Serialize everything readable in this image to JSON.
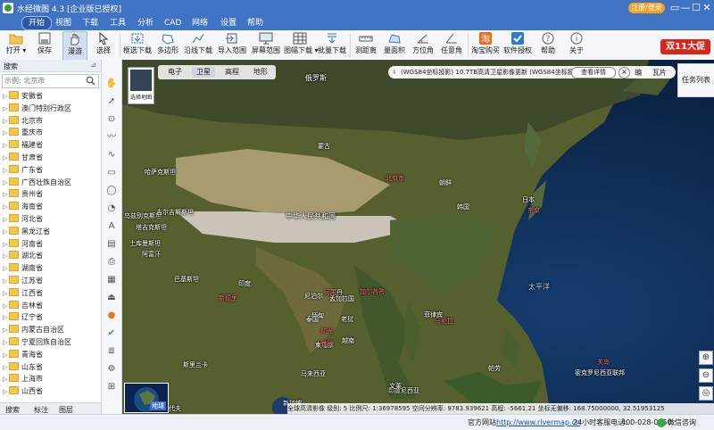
{
  "window": {
    "title": "水经微图 4.3 [企业版已授权]",
    "login_label": "注册/登录",
    "controls": [
      "▭",
      "—",
      "☐",
      "✕"
    ]
  },
  "menu": [
    "开始",
    "视图",
    "下载",
    "工具",
    "分析",
    "CAD",
    "网络",
    "设置",
    "帮助"
  ],
  "ribbon": [
    {
      "label": "打开 ▾",
      "icon": "folder-icon"
    },
    {
      "label": "保存",
      "icon": "save-icon"
    },
    {
      "label": "漫游",
      "icon": "hand-icon",
      "selected": true
    },
    {
      "label": "选择",
      "icon": "cursor-icon"
    },
    {
      "label": "框选下载",
      "icon": "rect-download-icon"
    },
    {
      "label": "多边形",
      "icon": "polygon-icon"
    },
    {
      "label": "沿线下载",
      "icon": "polyline-download-icon"
    },
    {
      "label": "导入范围",
      "icon": "import-range-icon"
    },
    {
      "label": "屏幕范围",
      "icon": "screen-range-icon"
    },
    {
      "label": "图幅下载 ▾",
      "icon": "sheet-download-icon"
    },
    {
      "label": "批量下载",
      "icon": "batch-download-icon"
    },
    {
      "label": "测距离",
      "icon": "ruler-icon"
    },
    {
      "label": "量面积",
      "icon": "area-icon"
    },
    {
      "label": "方位角",
      "icon": "azimuth-icon"
    },
    {
      "label": "任意角",
      "icon": "angle-icon"
    },
    {
      "label": "淘宝购买",
      "icon": "taobao-icon"
    },
    {
      "label": "软件授权",
      "icon": "license-icon"
    },
    {
      "label": "帮助",
      "icon": "help-icon"
    },
    {
      "label": "关于",
      "icon": "about-icon"
    }
  ],
  "promo": "双11大促",
  "left_panel": {
    "title": "搜索",
    "search_placeholder": "示例: 北京市",
    "provinces": [
      "安徽省",
      "澳门特别行政区",
      "北京市",
      "重庆市",
      "福建省",
      "甘肃省",
      "广东省",
      "广西壮族自治区",
      "贵州省",
      "海南省",
      "河北省",
      "黑龙江省",
      "河南省",
      "湖北省",
      "湖南省",
      "江苏省",
      "江西省",
      "吉林省",
      "辽宁省",
      "内蒙古自治区",
      "宁夏回族自治区",
      "青海省",
      "山东省",
      "上海市",
      "山西省"
    ],
    "tabs": [
      "搜索",
      "标注",
      "图层"
    ]
  },
  "map": {
    "layer_tabs": [
      "电子",
      "卫星",
      "高程",
      "地形"
    ],
    "active_layer": "卫星",
    "thumb_label": "选择地图",
    "notice": "(WGS84坐标投影)   10.7TB高清卫星影像更新 (WGS84坐标投影",
    "notice_button": "查看详情",
    "right_items": [
      "瓦片",
      "编"
    ],
    "task_list": "任务列表",
    "overview_label": "地球",
    "zoom": [
      "⊕",
      "⊖"
    ],
    "labels": [
      {
        "text": "俄罗斯",
        "cls": "big"
      },
      {
        "text": "蒙古",
        "cls": ""
      },
      {
        "text": "哈萨克斯坦",
        "cls": ""
      },
      {
        "text": "乌兹别克斯坦",
        "cls": ""
      },
      {
        "text": "吉尔吉斯斯坦",
        "cls": ""
      },
      {
        "text": "塔吉克斯坦",
        "cls": ""
      },
      {
        "text": "土库曼斯坦",
        "cls": ""
      },
      {
        "text": "阿富汗",
        "cls": ""
      },
      {
        "text": "巴基斯坦",
        "cls": ""
      },
      {
        "text": "印度",
        "cls": ""
      },
      {
        "text": "尼泊尔",
        "cls": ""
      },
      {
        "text": "不丹",
        "cls": ""
      },
      {
        "text": "孟加拉国",
        "cls": ""
      },
      {
        "text": "新德里",
        "cls": "red"
      },
      {
        "text": "加尔各答",
        "cls": "red"
      },
      {
        "text": "中华人民共和国",
        "cls": "big"
      },
      {
        "text": "北京市",
        "cls": "red"
      },
      {
        "text": "朝鲜",
        "cls": ""
      },
      {
        "text": "韩国",
        "cls": ""
      },
      {
        "text": "日本",
        "cls": ""
      },
      {
        "text": "东京",
        "cls": "red"
      },
      {
        "text": "缅甸",
        "cls": ""
      },
      {
        "text": "老挝",
        "cls": ""
      },
      {
        "text": "泰国",
        "cls": ""
      },
      {
        "text": "越南",
        "cls": ""
      },
      {
        "text": "柬埔寨",
        "cls": ""
      },
      {
        "text": "菲律宾",
        "cls": ""
      },
      {
        "text": "马尼拉",
        "cls": "red"
      },
      {
        "text": "马来西亚",
        "cls": ""
      },
      {
        "text": "新加坡",
        "cls": ""
      },
      {
        "text": "斯里兰卡",
        "cls": ""
      },
      {
        "text": "印度尼西亚",
        "cls": ""
      },
      {
        "text": "文莱",
        "cls": ""
      },
      {
        "text": "帕劳",
        "cls": ""
      },
      {
        "text": "太平洋",
        "cls": "ocean"
      },
      {
        "text": "密克罗尼西亚联邦",
        "cls": ""
      },
      {
        "text": "关岛",
        "cls": "red"
      },
      {
        "text": "马尔代夫",
        "cls": ""
      },
      {
        "text": "仰光",
        "cls": "red"
      },
      {
        "text": "河内",
        "cls": "red"
      },
      {
        "text": "曼谷",
        "cls": "red"
      }
    ],
    "status": "全球高清影像  级别:   5  比例尺: 1:36978595    空间分辨率:   9783.939621    高程: -5661.21  坐标无偏移:   168.75000000, 32.51953125"
  },
  "statusbar": {
    "site_label": "官方网站:",
    "site": "http://www.rivermap.cn",
    "hotline_label": "24小时客服电话:",
    "hotline": "400-028-0050",
    "wechat": "微信咨询"
  },
  "colors": {
    "title_bar": "#3f73c4",
    "promo": "#d7261a",
    "login": "#f4a020",
    "ocean": "#0e2a4c",
    "land": "#5a6a3a"
  }
}
